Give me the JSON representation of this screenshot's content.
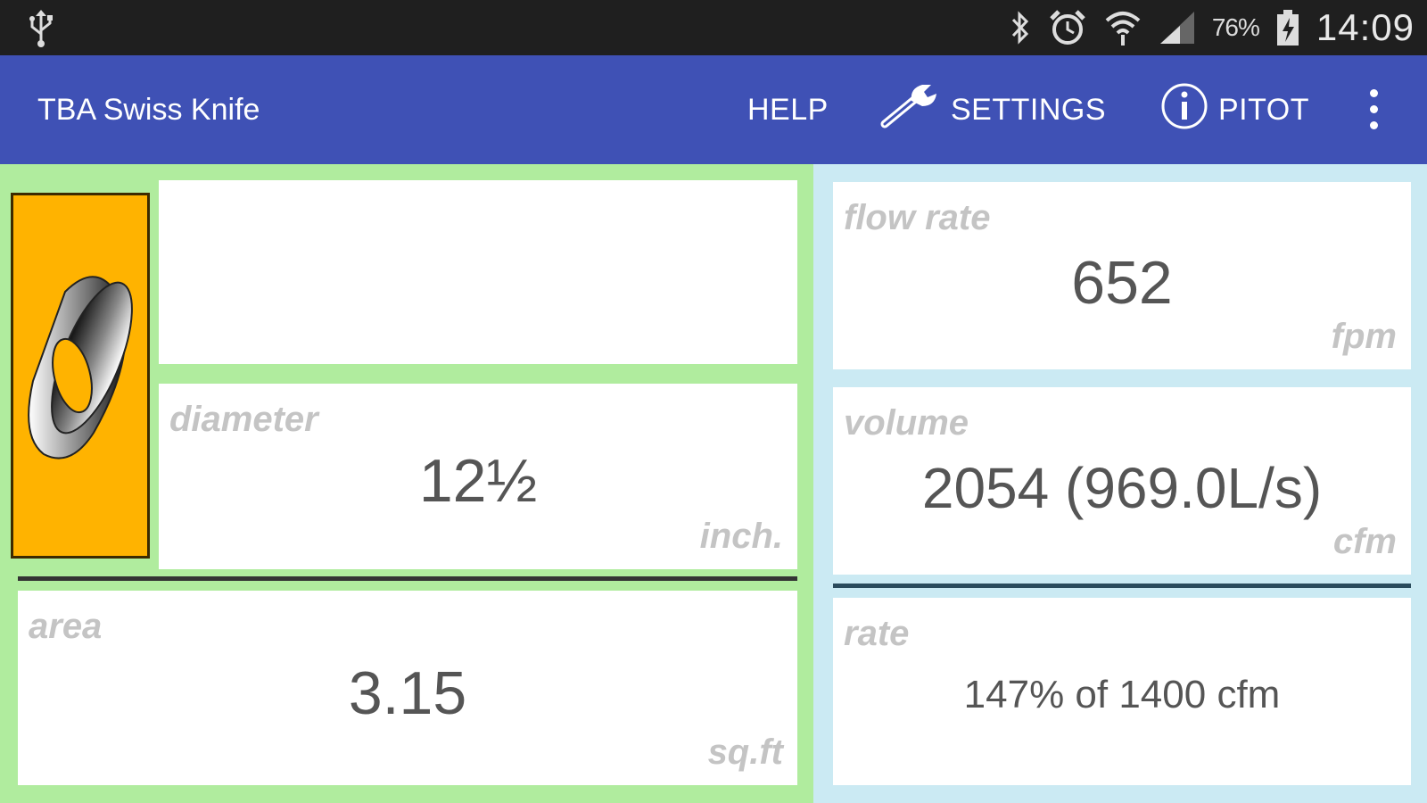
{
  "status_bar": {
    "battery_percent": "76%",
    "time": "14:09",
    "icons": [
      "usb-icon",
      "bluetooth-icon",
      "alarm-icon",
      "wifi-icon",
      "signal-icon",
      "battery-charging-icon"
    ]
  },
  "app_bar": {
    "title": "TBA Swiss Knife",
    "actions": {
      "help": "HELP",
      "settings": "SETTINGS",
      "pitot": "PITOT"
    },
    "color": "#3f51b5"
  },
  "left": {
    "name_field": "",
    "diameter": {
      "label": "diameter",
      "value": "12½",
      "unit": "inch."
    },
    "area": {
      "label": "area",
      "value": "3.15",
      "unit": "sq.ft"
    },
    "background": "#b0ec9e",
    "logo_background": "#ffb300"
  },
  "right": {
    "flow_rate": {
      "label": "flow rate",
      "value": "652",
      "unit": "fpm"
    },
    "volume": {
      "label": "volume",
      "value": "2054 (969.0L/s)",
      "unit": "cfm"
    },
    "rate": {
      "label": "rate",
      "value": "147% of 1400 cfm"
    },
    "background": "#cbeaf3"
  }
}
